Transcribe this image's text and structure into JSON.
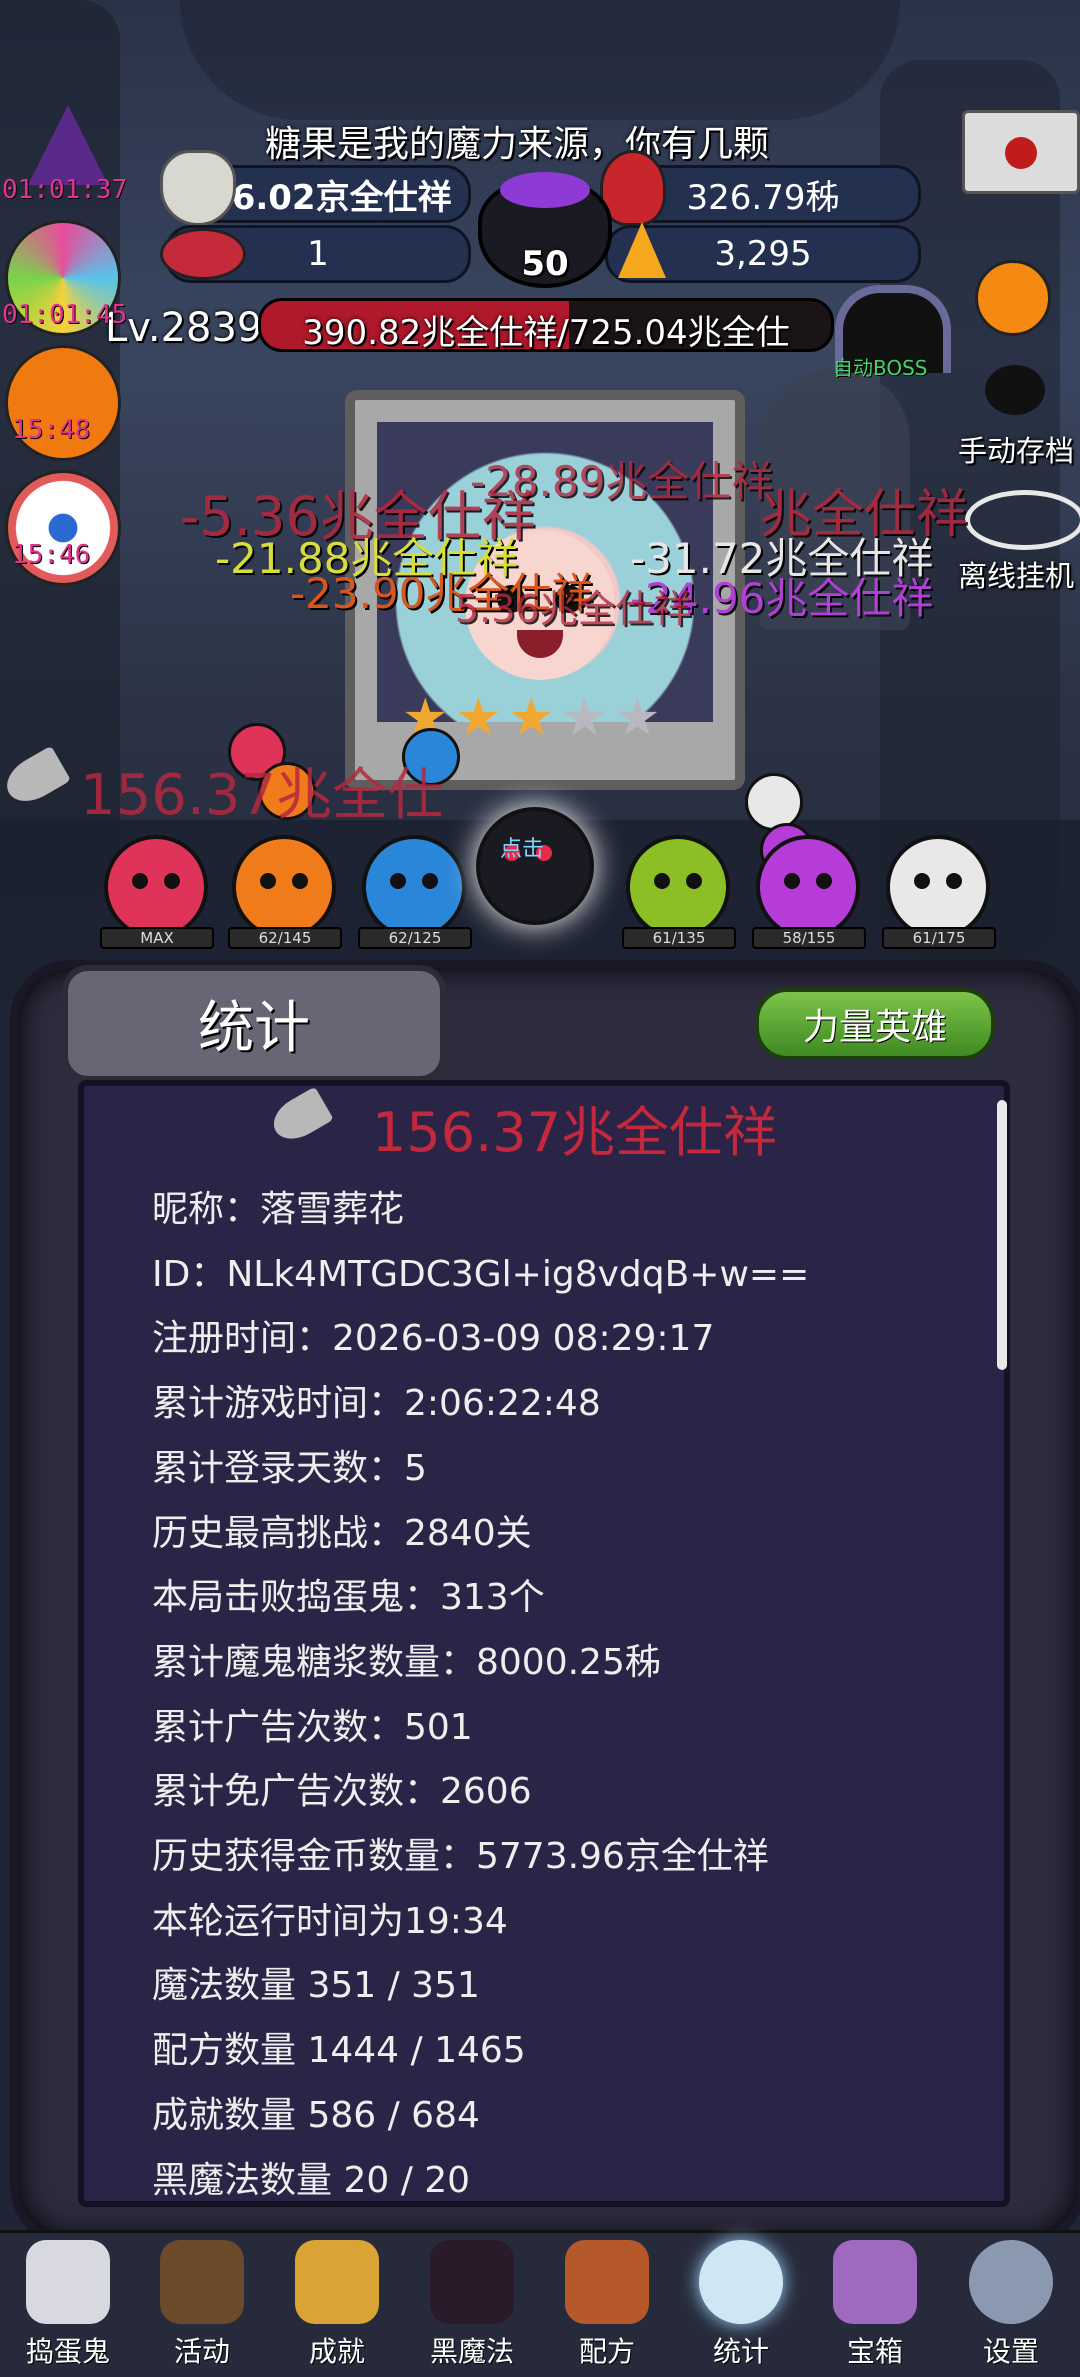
{
  "hud": {
    "banner": "糖果是我的魔力来源，你有几颗",
    "gold": "206.02京全仕祥",
    "potion": "326.79秭",
    "skull_count": "1",
    "cauldron_level": "50",
    "candy_corn": "3,295",
    "level": "Lv.2839",
    "boss_hp": "390.82兆全仕祥/725.04兆全仕",
    "auto_boss": "自动BOSS",
    "manual_save": "手动存档",
    "offline_idle": "离线挂机"
  },
  "side_timers": [
    "01:01:37",
    "01:01:45",
    "15:48",
    "15:46"
  ],
  "damage_texts": [
    {
      "text": "-5.36兆全仕祥",
      "color": "#b52840"
    },
    {
      "text": "-28.89兆全仕祥",
      "color": "#b52840"
    },
    {
      "text": "兆全仕祥",
      "color": "#b52840"
    },
    {
      "text": "-21.88兆全仕祥",
      "color": "#d7dd3c"
    },
    {
      "text": "-31.72兆全仕祥",
      "color": "#e6e6e6"
    },
    {
      "text": "-23.90兆全仕祥",
      "color": "#d9571f"
    },
    {
      "text": "-24.96兆全仕祥",
      "color": "#b23fd6"
    },
    {
      "text": "5.36兆全仕祥",
      "color": "#b52840"
    }
  ],
  "axe_damage": "156.37兆全仕",
  "monsters": [
    {
      "hp": "MAX",
      "color": "#e0335a"
    },
    {
      "hp": "62/145",
      "color": "#f07b1a"
    },
    {
      "hp": "62/125",
      "color": "#2a86d8"
    },
    {
      "hp": "点击",
      "color": "#1a1a22"
    },
    {
      "hp": "61/135",
      "color": "#8bbf25"
    },
    {
      "hp": "58/155",
      "color": "#b53cd6"
    },
    {
      "hp": "61/175",
      "color": "#e8e8e8"
    }
  ],
  "portrait_stars": {
    "filled": 3,
    "total": 5
  },
  "panel": {
    "tab_title": "统计",
    "power_hero_button": "力量英雄",
    "total_damage": "156.37兆全仕祥",
    "stats": [
      "昵称：落雪葬花",
      "ID：NLk4MTGDC3Gl+ig8vdqB+w==",
      "注册时间：2026-03-09 08:29:17",
      "累计游戏时间：2:06:22:48",
      "累计登录天数：5",
      "历史最高挑战：2840关",
      "本局击败捣蛋鬼：313个",
      "累计魔鬼糖浆数量：8000.25秭",
      "累计广告次数：501",
      "累计免广告次数：2606",
      "历史获得金币数量：5773.96京全仕祥",
      "本轮运行时间为19:34",
      "魔法数量 351 / 351",
      "配方数量 1444 / 1465",
      "成就数量 586 / 684",
      "黑魔法数量 20 / 20"
    ]
  },
  "nav": [
    {
      "label": "捣蛋鬼",
      "icon": "ghost-icon",
      "color": "#d8d8e0"
    },
    {
      "label": "活动",
      "icon": "cauldron-icon",
      "color": "#6a4a2a"
    },
    {
      "label": "成就",
      "icon": "skull-trophy-icon",
      "color": "#d9a336"
    },
    {
      "label": "黑魔法",
      "icon": "demon-icon",
      "color": "#2a1a2a"
    },
    {
      "label": "配方",
      "icon": "book-icon",
      "color": "#b5592a"
    },
    {
      "label": "统计",
      "icon": "crystal-ball-icon",
      "color": "#cfe6f4"
    },
    {
      "label": "宝箱",
      "icon": "chest-icon",
      "color": "#a069c0"
    },
    {
      "label": "设置",
      "icon": "gear-icon",
      "color": "#8a98b0"
    }
  ]
}
